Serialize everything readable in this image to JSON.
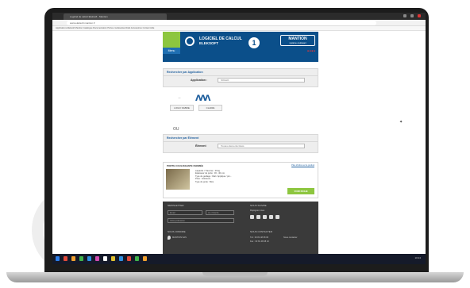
{
  "browser": {
    "tab_title": "Logiciel de calcul Eleksoft - Mantion",
    "url": "www.eleksoft.mantion.fr",
    "bookmarks": "Applications  Eleksoft  Mantion  Catalogue  Documentation  Portes coulissantes  Rails  Accessoires  Contact  Aide"
  },
  "header": {
    "menu_label": "Menu",
    "title_line1": "LOGICIEL DE CALCUL",
    "title_line2": "ELEKSOFT",
    "step_number": "1",
    "brand_name": "MANTION",
    "brand_tagline": "système coulissant",
    "flags": "■ ■ ■ ■"
  },
  "search_application": {
    "title": "Rechercher par Application",
    "label": "Application :",
    "value": "SOLEO",
    "icon_label": "ʌʌʌ",
    "btn_left": "LOGO SABRE",
    "btn_right": "CLAIRE"
  },
  "mid_label": "OU",
  "search_element": {
    "title": "Rechercher par Élément",
    "label": "Élément",
    "value": "Toutes éléments listés"
  },
  "product_card": {
    "title": "PORTE COULISSANTE FERMÉE",
    "link": "Plus d'infos sur le produit",
    "lines": [
      "Capacité / Traverse :  40 kg",
      "Épaisseur de porte :  30 - 40 mm",
      "Type de guidage :  Rail / Applique / pro...",
      "Pose :  Intérieure",
      "Type de porte :  Bois"
    ],
    "action": "VOIR FICHE"
  },
  "footer": {
    "col1_title": "NEWSLETTER",
    "col1_field1": "Email",
    "col1_field2": "Je m'inscris",
    "col1_field3": "Votre profession",
    "col2_title": "NOUS SUIVRE",
    "col2_text": "Rejoignez-nous",
    "addr_title": "NOUS JOINDRE",
    "addr_line": "MANTION SAS",
    "contact_title": "NOUS CONTACTER",
    "phone": "Tél : 03 81 48 08 00",
    "fax": "Fax : 03 81 48 08 10",
    "mail": "Nous contacter"
  },
  "taskbar": {
    "clock": "10:24"
  }
}
